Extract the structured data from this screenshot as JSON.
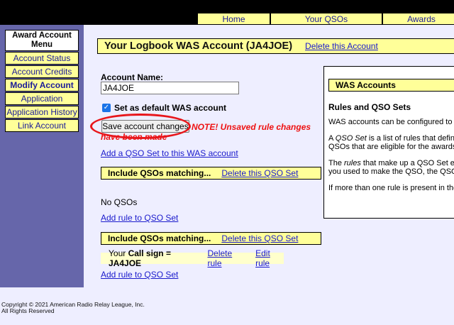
{
  "topnav": {
    "home": "Home",
    "qsos": "Your QSOs",
    "awards": "Awards"
  },
  "menu": {
    "title": "Award Account Menu",
    "items": [
      {
        "label": "Account Status"
      },
      {
        "label": "Account Credits"
      },
      {
        "label": "Modify Account"
      },
      {
        "label": "Application"
      },
      {
        "label": "Application History"
      },
      {
        "label": "Link Account"
      }
    ]
  },
  "header": {
    "title": "Your Logbook WAS Account (JA4JOE)",
    "delete_link": "Delete this Account"
  },
  "form": {
    "account_name_label": "Account Name:",
    "account_name_value": "JA4JOE",
    "default_label": "Set as default WAS account",
    "save_button": "Save account changes",
    "warning": "NOTE! Unsaved rule changes have been made",
    "add_qso_set": "Add a QSO Set to this WAS account"
  },
  "qso_sets": [
    {
      "title": "Include QSOs matching...",
      "delete": "Delete this QSO Set",
      "empty": "No QSOs",
      "add_rule": "Add rule to QSO Set"
    },
    {
      "title": "Include QSOs matching...",
      "delete": "Delete this QSO Set",
      "rule": {
        "prefix": "Your ",
        "text": "Call sign = JA4JOE",
        "delete": "Delete rule",
        "edit": "Edit rule"
      },
      "add_rule": "Add rule to QSO Set"
    }
  ],
  "info": {
    "heading": "WAS Accounts",
    "subheading": "Rules and QSO Sets",
    "p1": "WAS accounts can be configured to a",
    "p2a": "A ",
    "p2em": "QSO Set",
    "p2b": " is a list of rules that define",
    "p2c": "QSOs that are eligible for the awards.",
    "p3a": "The ",
    "p3em": "rules",
    "p3b": " that make up a QSO Set ea",
    "p3c": "you used to make the QSO, the QSO",
    "p4": "If more than one rule is present in the"
  },
  "footer": {
    "line1": "Copyright © 2021 American Radio Relay League, Inc.",
    "line2": "All Rights Reserved"
  }
}
